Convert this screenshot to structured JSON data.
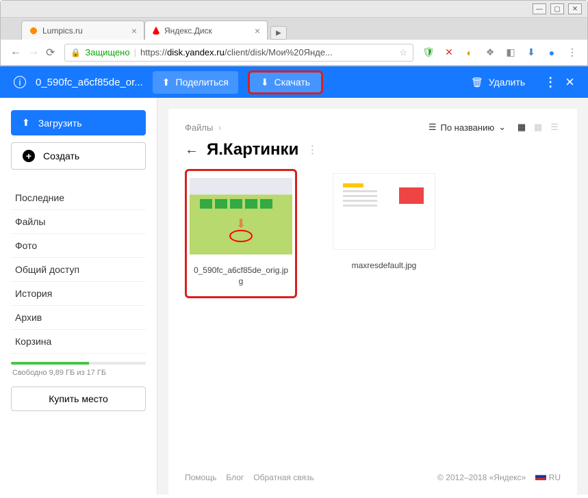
{
  "window": {
    "tabs": [
      {
        "title": "Lumpics.ru"
      },
      {
        "title": "Яндекс.Диск"
      }
    ]
  },
  "addressBar": {
    "secure_label": "Защищено",
    "url_prefix": "https://",
    "url_domain": "disk.yandex.ru",
    "url_path": "/client/disk/Мои%20Янде..."
  },
  "actionBar": {
    "filename": "0_590fc_a6cf85de_or...",
    "share_label": "Поделиться",
    "download_label": "Скачать",
    "delete_label": "Удалить"
  },
  "sidebar": {
    "upload_label": "Загрузить",
    "create_label": "Создать",
    "nav": [
      "Последние",
      "Файлы",
      "Фото",
      "Общий доступ",
      "История",
      "Архив",
      "Корзина"
    ],
    "storage_text": "Свободно 9,89 ГБ из 17 ГБ",
    "buy_label": "Купить место"
  },
  "content": {
    "breadcrumb_root": "Файлы",
    "sort_label": "По названию",
    "folder_title": "Я.Картинки",
    "files": [
      {
        "name": "0_590fc_a6cf85de_orig.jpg"
      },
      {
        "name": "maxresdefault.jpg"
      }
    ]
  },
  "footer": {
    "links": [
      "Помощь",
      "Блог",
      "Обратная связь"
    ],
    "copyright": "© 2012–2018 «Яндекс»",
    "lang": "RU"
  }
}
